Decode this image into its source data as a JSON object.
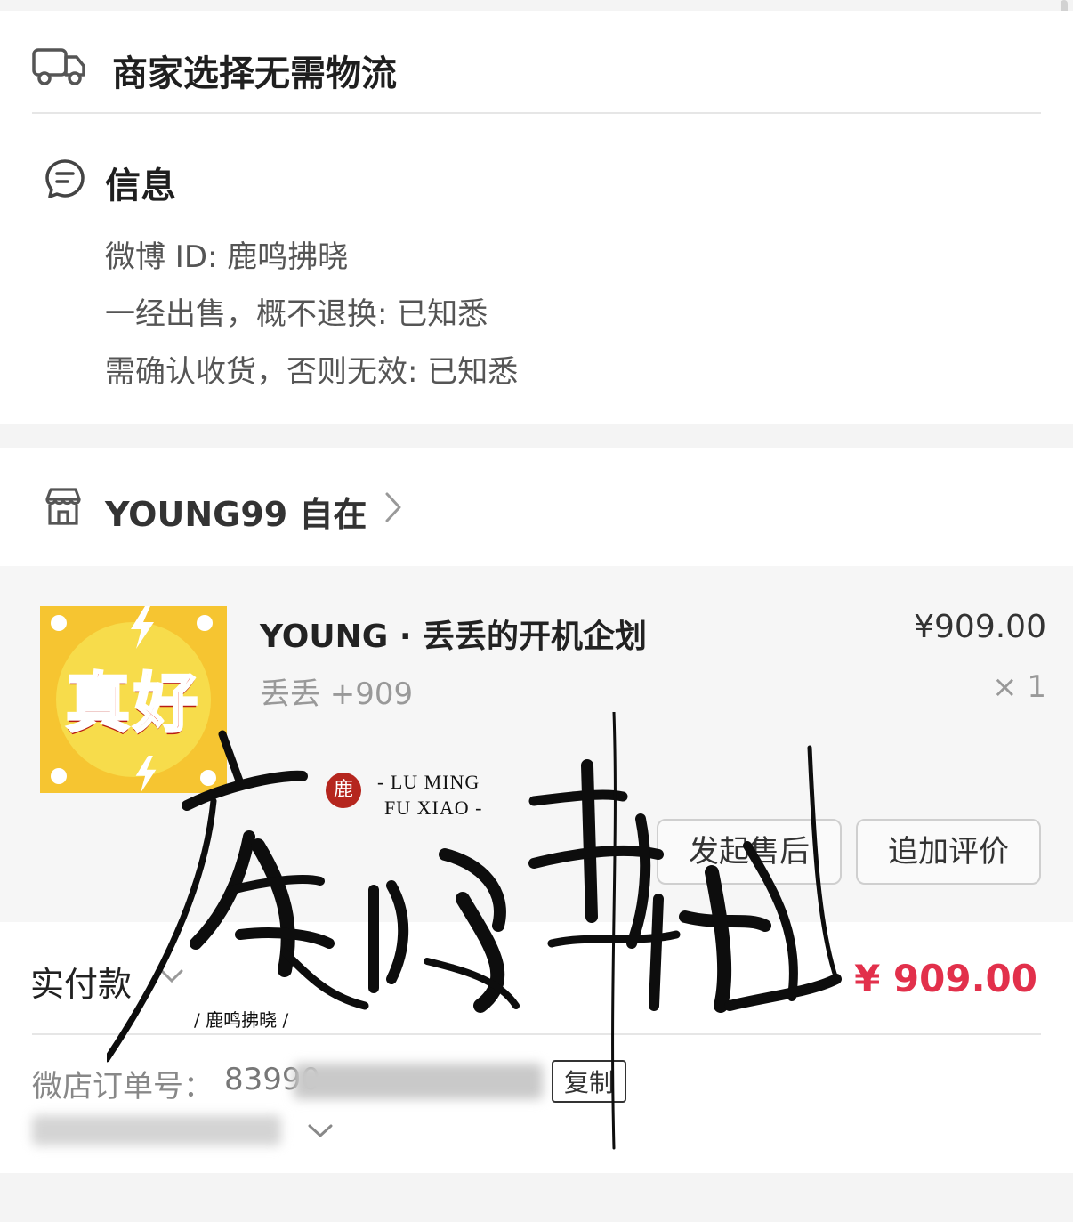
{
  "logistics": {
    "icon": "truck-icon",
    "text": "商家选择无需物流"
  },
  "info": {
    "icon": "message-icon",
    "title": "信息",
    "lines": [
      "微博 ID: 鹿鸣拂晓",
      "一经出售，概不退换: 已知悉",
      "需确认收货，否则无效: 已知悉"
    ]
  },
  "shop": {
    "icon": "store-icon",
    "name": "YOUNG99 自在",
    "chevron": "chevron-right-icon"
  },
  "product": {
    "thumb_text": "真好",
    "title": "YOUNG · 丢丢的开机企划",
    "spec": "丢丢 +909",
    "price": "¥909.00",
    "qty": "× 1",
    "buttons": {
      "after_sale": "发起售后",
      "add_review": "追加评价"
    }
  },
  "payment": {
    "label": "实付款",
    "amount": "¥ 909.00"
  },
  "order": {
    "label": "微店订单号：",
    "number_visible": "83990",
    "copy": "复制"
  },
  "watermark": {
    "calligraphy": "鹿鸣拂晓",
    "seal": "鹿",
    "en_line1": "- LU MING",
    "en_line2": "FU XIAO -",
    "caption": "/ 鹿鸣拂晓 /"
  },
  "colors": {
    "accent": "#e2304b",
    "divider": "#e6e6e6",
    "band": "#f6f6f6"
  }
}
